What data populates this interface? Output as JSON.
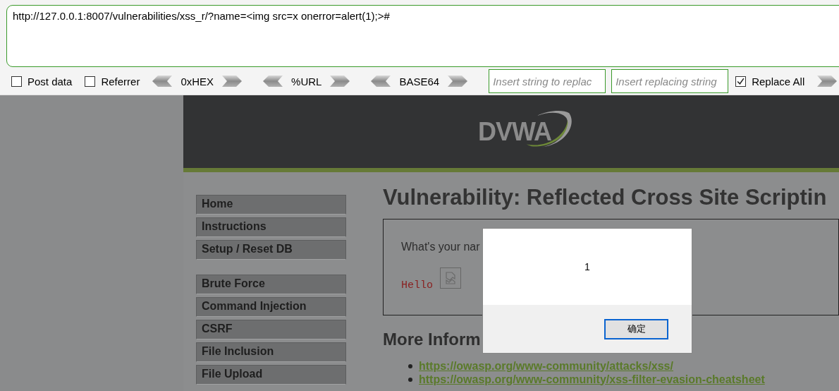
{
  "address_bar": {
    "value": "http://127.0.0.1:8007/vulnerabilities/xss_r/?name=<img src=x onerror=alert(1);>#"
  },
  "toolbar": {
    "items": [
      {
        "kind": "checkbox",
        "label": "Post data",
        "checked": false
      },
      {
        "kind": "checkbox",
        "label": "Referrer",
        "checked": false
      },
      {
        "kind": "encoder",
        "label": "0xHEX"
      },
      {
        "kind": "encoder",
        "label": "%URL"
      },
      {
        "kind": "encoder",
        "label": "BASE64"
      },
      {
        "kind": "input",
        "placeholder": "Insert string to replac"
      },
      {
        "kind": "input",
        "placeholder": "Insert replacing string"
      },
      {
        "kind": "checkbox",
        "label": "Replace All",
        "checked": true
      },
      {
        "kind": "execute"
      }
    ]
  },
  "page": {
    "logo": "DVWA",
    "menu_groups": [
      {
        "items": [
          "Home",
          "Instructions",
          "Setup / Reset DB"
        ]
      },
      {
        "items": [
          "Brute Force",
          "Command Injection",
          "CSRF",
          "File Inclusion",
          "File Upload"
        ]
      }
    ],
    "title": "Vulnerability: Reflected Cross Site Scriptin",
    "form": {
      "prompt": "What's your nar",
      "output": "Hello"
    },
    "more_heading": "More Inform",
    "links": [
      "https://owasp.org/www-community/attacks/xss/",
      "https://owasp.org/www-community/xss-filter-evasion-cheatsheet"
    ]
  },
  "dialog": {
    "message": "1",
    "button": "确定"
  }
}
